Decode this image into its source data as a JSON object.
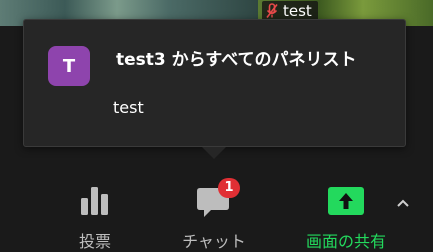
{
  "video": {
    "participant_name": "test"
  },
  "notification": {
    "avatar_letter": "T",
    "title": "test3 からすべてのパネリスト",
    "message": "test"
  },
  "toolbar": {
    "vote_label": "投票",
    "chat_label": "チャット",
    "chat_badge": "1",
    "share_label": "画面の共有"
  },
  "colors": {
    "avatar": "#8e44ad",
    "share_green": "#23d95d",
    "badge_red": "#e02f34",
    "popup_bg": "#262626"
  },
  "icons": [
    "mic-muted-icon",
    "poll-icon",
    "chat-icon",
    "share-screen-icon",
    "chevron-up-icon"
  ]
}
